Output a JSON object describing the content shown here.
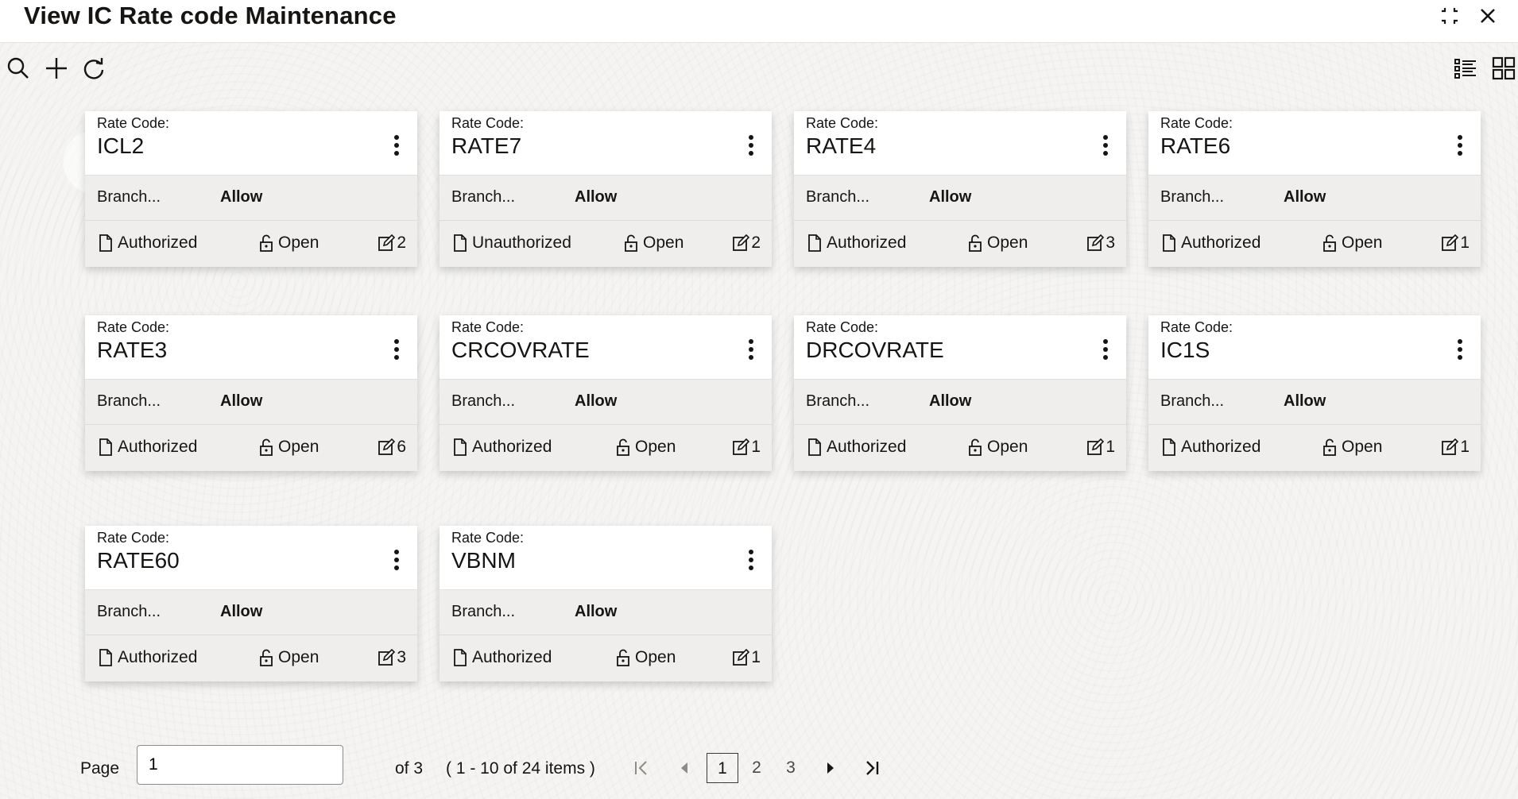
{
  "window": {
    "title": "View IC Rate code Maintenance"
  },
  "icons": {
    "minimize": "compress-icon",
    "close": "close-icon",
    "search": "search-icon",
    "add": "plus-icon",
    "refresh": "refresh-icon",
    "list_view": "list-view-icon",
    "tile_view": "tile-view-icon"
  },
  "cards": [
    {
      "rate_code_label": "Rate Code:",
      "rate_code": "ICL2",
      "branch_label": "Branch...",
      "branch_value": "Allow",
      "status": "Authorized",
      "lock": "Open",
      "edits": "2"
    },
    {
      "rate_code_label": "Rate Code:",
      "rate_code": "RATE7",
      "branch_label": "Branch...",
      "branch_value": "Allow",
      "status": "Unauthorized",
      "lock": "Open",
      "edits": "2"
    },
    {
      "rate_code_label": "Rate Code:",
      "rate_code": "RATE4",
      "branch_label": "Branch...",
      "branch_value": "Allow",
      "status": "Authorized",
      "lock": "Open",
      "edits": "3"
    },
    {
      "rate_code_label": "Rate Code:",
      "rate_code": "RATE6",
      "branch_label": "Branch...",
      "branch_value": "Allow",
      "status": "Authorized",
      "lock": "Open",
      "edits": "1"
    },
    {
      "rate_code_label": "Rate Code:",
      "rate_code": "RATE3",
      "branch_label": "Branch...",
      "branch_value": "Allow",
      "status": "Authorized",
      "lock": "Open",
      "edits": "6"
    },
    {
      "rate_code_label": "Rate Code:",
      "rate_code": "CRCOVRATE",
      "branch_label": "Branch...",
      "branch_value": "Allow",
      "status": "Authorized",
      "lock": "Open",
      "edits": "1"
    },
    {
      "rate_code_label": "Rate Code:",
      "rate_code": "DRCOVRATE",
      "branch_label": "Branch...",
      "branch_value": "Allow",
      "status": "Authorized",
      "lock": "Open",
      "edits": "1"
    },
    {
      "rate_code_label": "Rate Code:",
      "rate_code": "IC1S",
      "branch_label": "Branch...",
      "branch_value": "Allow",
      "status": "Authorized",
      "lock": "Open",
      "edits": "1"
    },
    {
      "rate_code_label": "Rate Code:",
      "rate_code": "RATE60",
      "branch_label": "Branch...",
      "branch_value": "Allow",
      "status": "Authorized",
      "lock": "Open",
      "edits": "3"
    },
    {
      "rate_code_label": "Rate Code:",
      "rate_code": "VBNM",
      "branch_label": "Branch...",
      "branch_value": "Allow",
      "status": "Authorized",
      "lock": "Open",
      "edits": "1"
    }
  ],
  "pager": {
    "page_label": "Page",
    "page_value": "1",
    "of_label": "of 3",
    "range_label": "( 1 - 10 of 24 items )",
    "pages": [
      "1",
      "2",
      "3"
    ],
    "current_page": "1"
  }
}
